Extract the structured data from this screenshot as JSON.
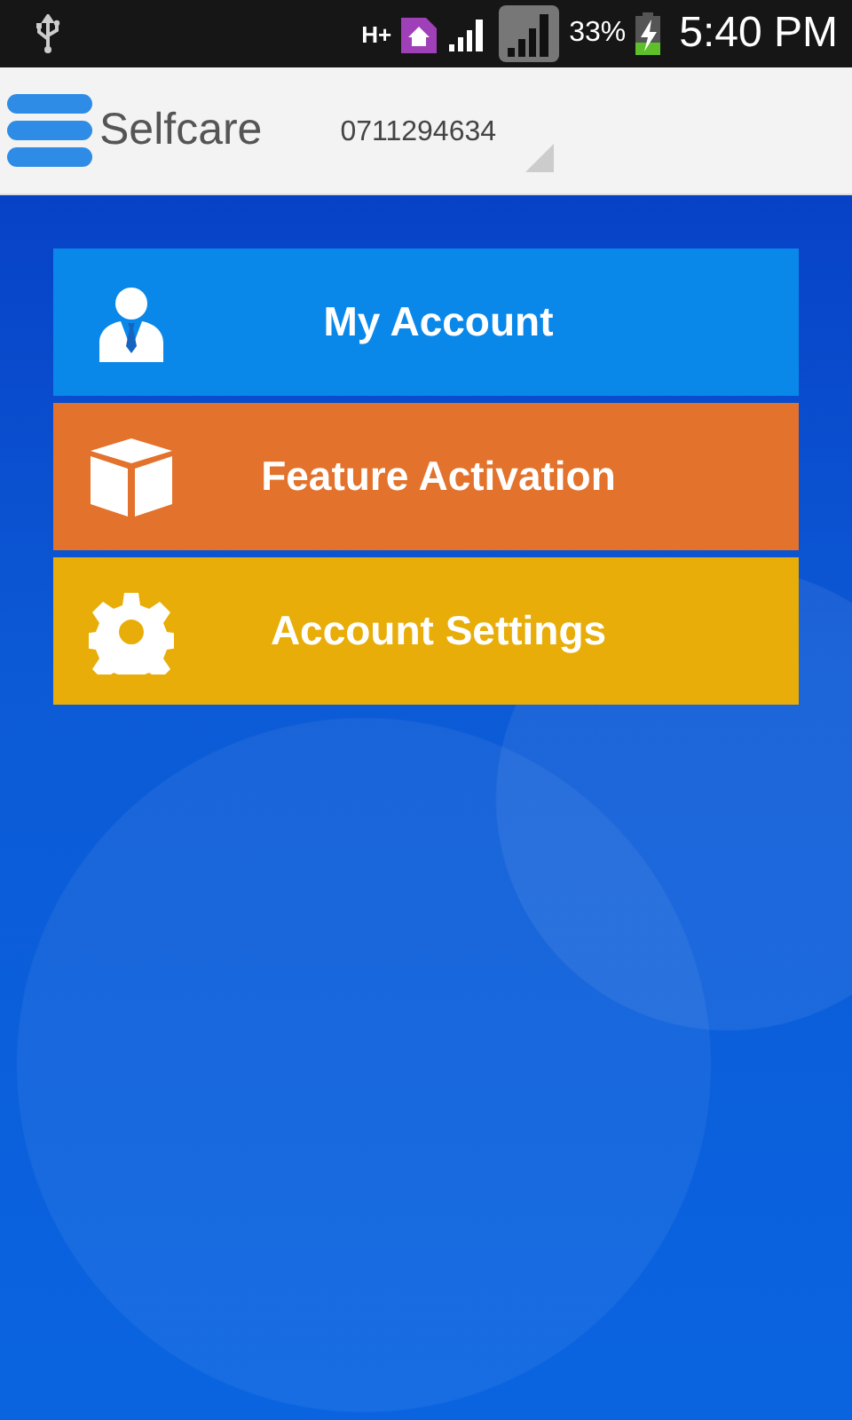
{
  "status_bar": {
    "network_type": "H+",
    "battery": "33%",
    "time": "5:40 PM"
  },
  "app_bar": {
    "title": "Selfcare",
    "account_number": "0711294634"
  },
  "menu": [
    {
      "label": "My Account",
      "kind": "person",
      "color": "#0a88ea"
    },
    {
      "label": "Feature Activation",
      "kind": "box",
      "color": "#e2722c"
    },
    {
      "label": "Account Settings",
      "kind": "gear",
      "color": "#e8ad08"
    }
  ]
}
